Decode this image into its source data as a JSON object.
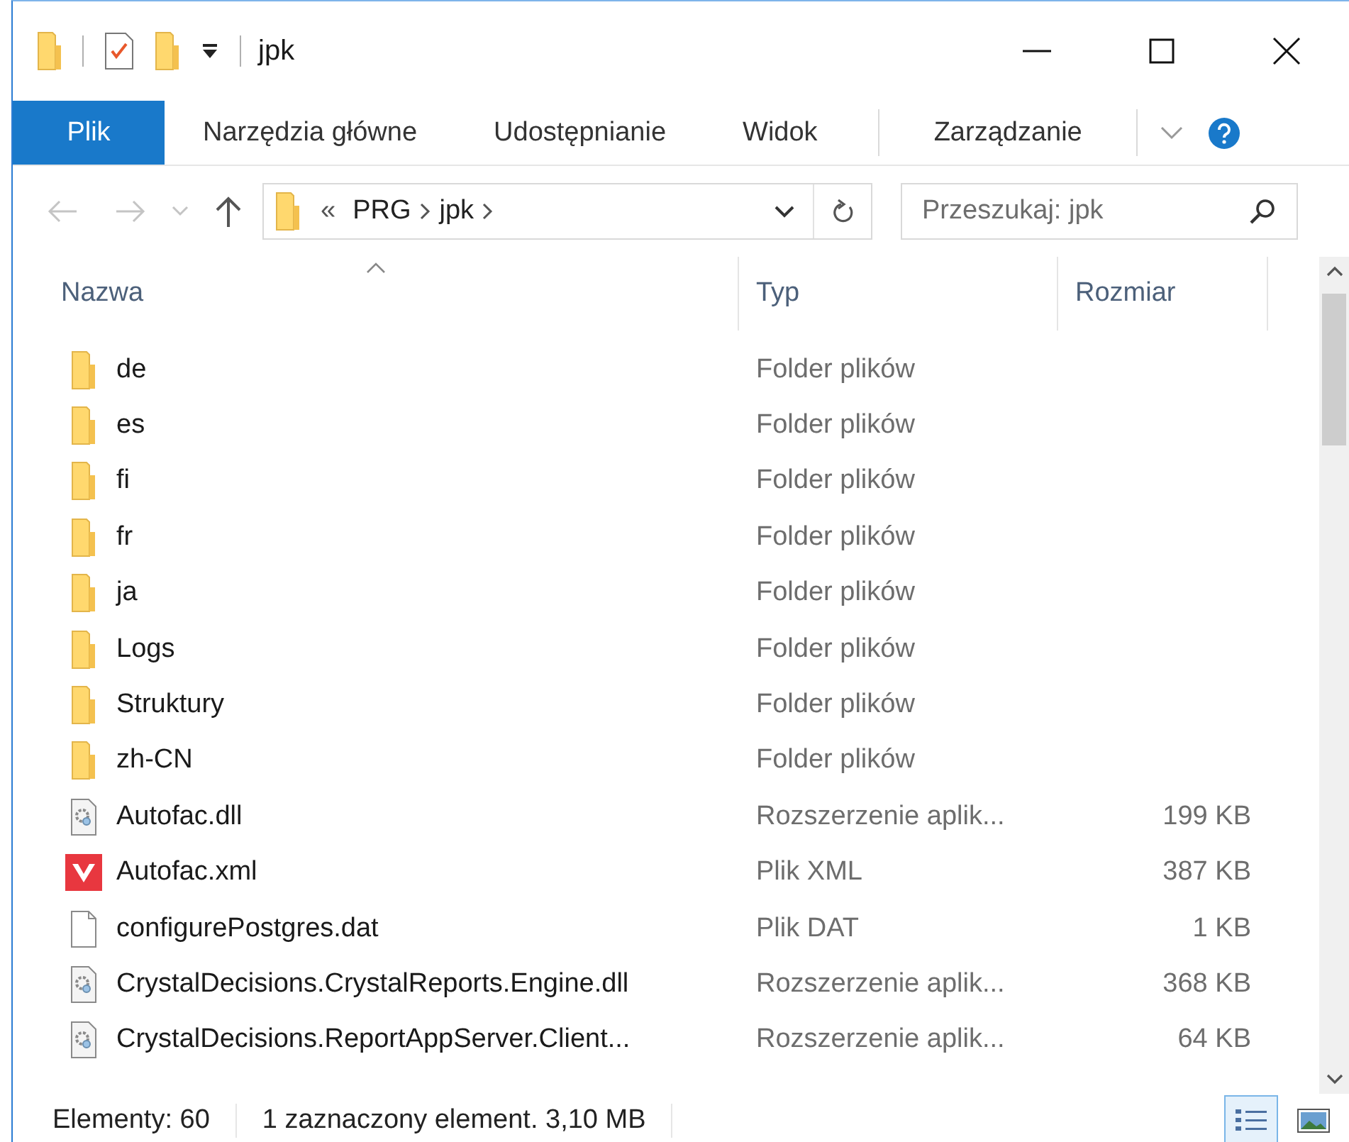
{
  "window": {
    "title": "jpk"
  },
  "ribbon": {
    "tabs": [
      {
        "label": "Plik",
        "kind": "file"
      },
      {
        "label": "Narzędzia główne",
        "kind": "tab"
      },
      {
        "label": "Udostępnianie",
        "kind": "tab"
      },
      {
        "label": "Widok",
        "kind": "tab"
      },
      {
        "label": "Zarządzanie",
        "kind": "contextual"
      }
    ]
  },
  "address": {
    "overflow": "«",
    "path": [
      "PRG",
      "jpk"
    ],
    "search_placeholder": "Przeszukaj: jpk"
  },
  "columns": [
    {
      "label": "Nazwa",
      "sorted": true
    },
    {
      "label": "Typ",
      "sorted": false
    },
    {
      "label": "Rozmiar",
      "sorted": false
    }
  ],
  "rows": [
    {
      "kind": "folder",
      "name": "de",
      "type": "Folder plików"
    },
    {
      "kind": "folder",
      "name": "es",
      "type": "Folder plików"
    },
    {
      "kind": "folder",
      "name": "fi",
      "type": "Folder plików"
    },
    {
      "kind": "folder",
      "name": "fr",
      "type": "Folder plików"
    },
    {
      "kind": "folder",
      "name": "ja",
      "type": "Folder plików"
    },
    {
      "kind": "folder",
      "name": "Logs",
      "type": "Folder plików"
    },
    {
      "kind": "folder",
      "name": "Struktury",
      "type": "Folder plików"
    },
    {
      "kind": "folder",
      "name": "zh-CN",
      "type": "Folder plików"
    },
    {
      "kind": "dll",
      "name": "Autofac.dll",
      "type": "Rozszerzenie aplik...",
      "size": "199 KB"
    },
    {
      "kind": "xml",
      "name": "Autofac.xml",
      "type": "Plik XML",
      "size": "387 KB"
    },
    {
      "kind": "file",
      "name": "configurePostgres.dat",
      "type": "Plik DAT",
      "size": "1 KB"
    },
    {
      "kind": "dll",
      "name": "CrystalDecisions.CrystalReports.Engine.dll",
      "type": "Rozszerzenie aplik...",
      "size": "368 KB"
    },
    {
      "kind": "dll",
      "name": "CrystalDecisions.ReportAppServer.Client...",
      "type": "Rozszerzenie aplik...",
      "size": "64 KB"
    }
  ],
  "status_bar": {
    "count": "Elementy: 60",
    "selection": "1 zaznaczony element. 3,10 MB",
    "views": [
      {
        "kind": "details",
        "selected": true
      },
      {
        "kind": "tiles",
        "selected": false
      }
    ]
  }
}
